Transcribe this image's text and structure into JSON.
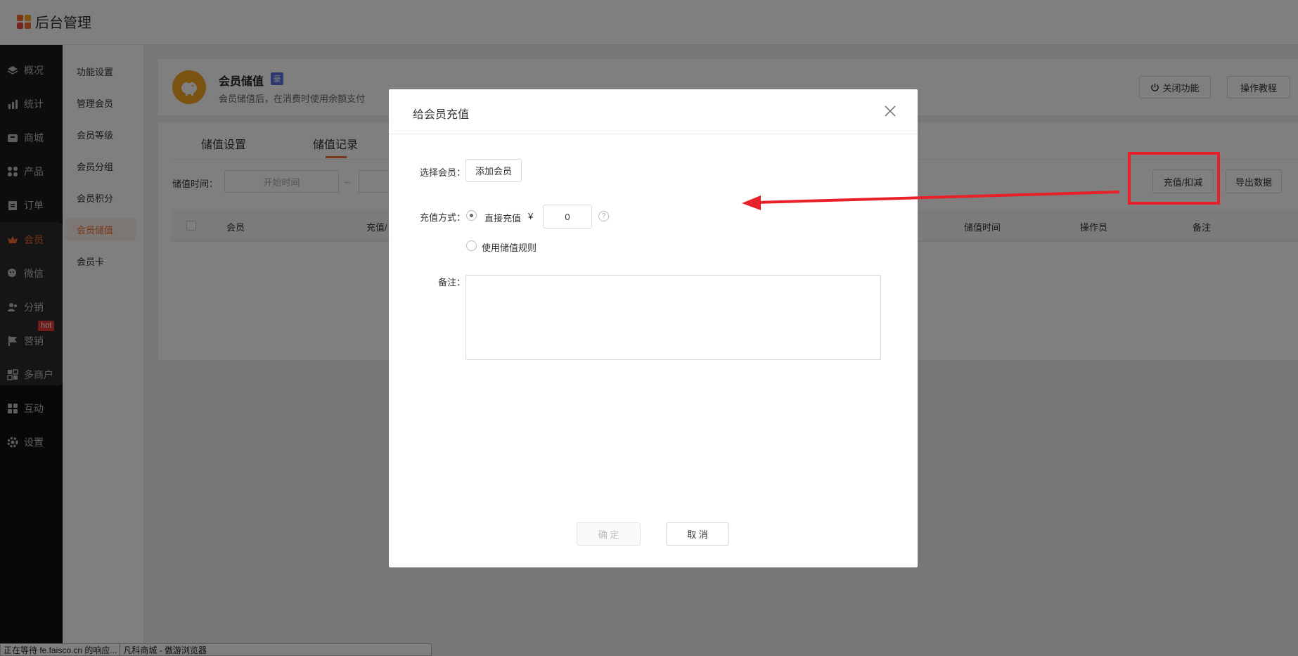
{
  "app": {
    "title": "后台管理"
  },
  "nav": {
    "items": [
      {
        "label": "概况",
        "icon": "layers-icon"
      },
      {
        "label": "统计",
        "icon": "chart-icon"
      },
      {
        "label": "商城",
        "icon": "store-icon"
      },
      {
        "label": "产品",
        "icon": "grid-icon"
      },
      {
        "label": "订单",
        "icon": "clipboard-icon"
      },
      {
        "label": "会员",
        "icon": "crown-icon"
      },
      {
        "label": "微信",
        "icon": "wechat-icon"
      },
      {
        "label": "分销",
        "icon": "users-icon"
      },
      {
        "label": "营销",
        "icon": "flag-icon"
      },
      {
        "label": "多商户",
        "icon": "shop-icon"
      },
      {
        "label": "互动",
        "icon": "apps-icon"
      },
      {
        "label": "设置",
        "icon": "gear-icon"
      }
    ],
    "active": "会员",
    "hot_badge": "hot"
  },
  "subnav": {
    "items": [
      "功能设置",
      "管理会员",
      "会员等级",
      "会员分组",
      "会员积分",
      "会员储值",
      "会员卡"
    ],
    "active": "会员储值"
  },
  "feature": {
    "title": "会员储值",
    "badge": "豪",
    "description": "会员储值后，在消费时使用余额支付",
    "close_label": "关闭功能",
    "tutorial_label": "操作教程"
  },
  "tabs": [
    "储值设置",
    "储值记录"
  ],
  "filter": {
    "label": "储值时间：",
    "start_placeholder": "开始时间",
    "separator": "–",
    "recharge_label": "充值/扣减",
    "export_label": "导出数据"
  },
  "table": {
    "columns": [
      "会员",
      "充值/",
      "储值时间",
      "操作员",
      "备注"
    ]
  },
  "modal": {
    "title": "给会员充值",
    "select_member_label": "选择会员：",
    "add_member_label": "添加会员",
    "method_label": "充值方式：",
    "direct_label": "直接充值",
    "currency": "¥",
    "amount_value": "0",
    "help": "?",
    "rule_label": "使用储值规则",
    "note_label": "备注：",
    "confirm_label": "确 定",
    "cancel_label": "取 消"
  },
  "status_bar": {
    "text": "正在等待 fe.faisco.cn 的响应...",
    "tab": "凡科商城 - 傲游浏览器"
  },
  "colors": {
    "accent": "#f06a2e",
    "annotation": "#e8202a",
    "vip_badge": "#5b6ee1"
  }
}
